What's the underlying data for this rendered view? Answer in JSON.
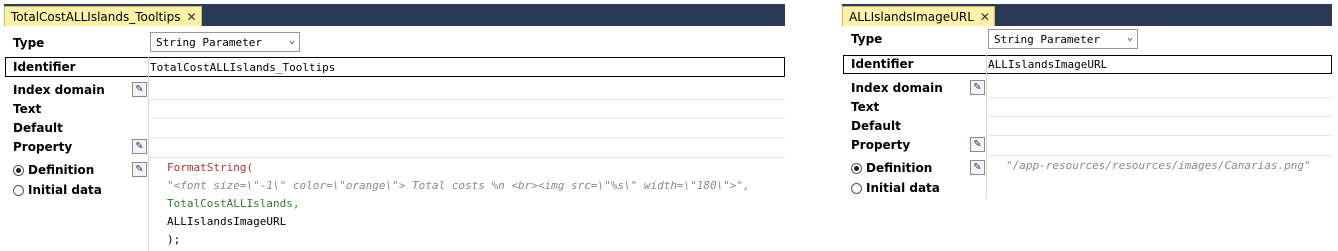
{
  "left": {
    "tab_label": "TotalCostALLIslands_Tooltips",
    "close_glyph": "✕",
    "type_label": "Type",
    "type_value": "String Parameter",
    "identifier_label": "Identifier",
    "identifier_value": "TotalCostALLIslands_Tooltips",
    "index_domain_label": "Index domain",
    "text_label": "Text",
    "default_label": "Default",
    "property_label": "Property",
    "definition_label": "Definition",
    "initial_data_label": "Initial data",
    "definition_selected": true,
    "code_line1": "FormatString(",
    "code_line2": "\"<font size=\\\"-1\\\" color=\\\"orange\\\"> Total costs %n <br><img src=\\\"%s\\\" width=\\\"180\\\">\",",
    "code_line3": "TotalCostALLIslands,",
    "code_line4": "ALLIslandsImageURL",
    "code_line5": ");"
  },
  "right": {
    "tab_label": "ALLIslandsImageURL",
    "close_glyph": "✕",
    "type_label": "Type",
    "type_value": "String Parameter",
    "identifier_label": "Identifier",
    "identifier_value": "ALLIslandsImageURL",
    "index_domain_label": "Index domain",
    "text_label": "Text",
    "default_label": "Default",
    "property_label": "Property",
    "definition_label": "Definition",
    "initial_data_label": "Initial data",
    "definition_selected": true,
    "code_line1": "\"/app-resources/resources/images/Canarias.png\""
  },
  "icons": {
    "dropdown": "chevron-down-icon",
    "edit": "pencil-edit-icon",
    "close": "close-icon"
  },
  "colors": {
    "tab_bg": "#fff2a8",
    "tabbar_bg": "#2b3b56",
    "function": "#b03030",
    "string": "#888888",
    "identifier": "#2e7d2e"
  }
}
